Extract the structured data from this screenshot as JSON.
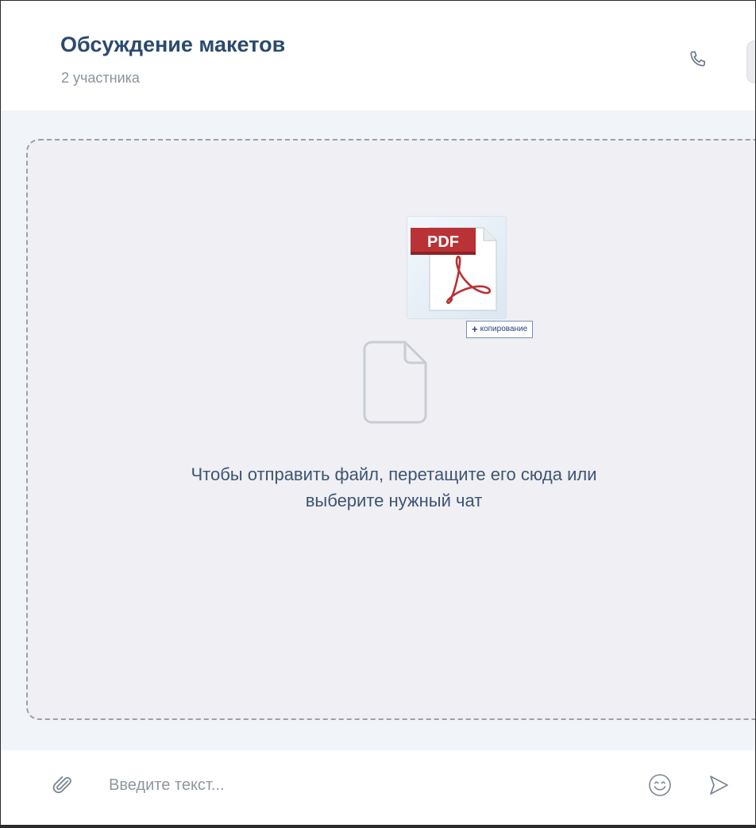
{
  "chat": {
    "title": "Обсуждение макетов",
    "subtitle": "2 участника"
  },
  "header": {
    "call_icon": "phone-icon"
  },
  "dropzone": {
    "hint": "Чтобы отправить файл, перетащите его сюда или выберите нужный чат",
    "file_icon": "file-icon",
    "drag_preview": {
      "badge_text": "PDF",
      "copy_label": "копирование",
      "copy_symbol": "+"
    }
  },
  "composer": {
    "placeholder": "Введите текст...",
    "attach_icon": "paperclip-icon",
    "emoji_icon": "smile-icon",
    "send_icon": "send-icon"
  },
  "colors": {
    "title": "#2b4a6f",
    "subtitle": "#8a939e",
    "body_bg": "#f1f4f9",
    "dropzone_bg": "#efeff4",
    "hint": "#3e5472",
    "pdf_red": "#b83236"
  }
}
